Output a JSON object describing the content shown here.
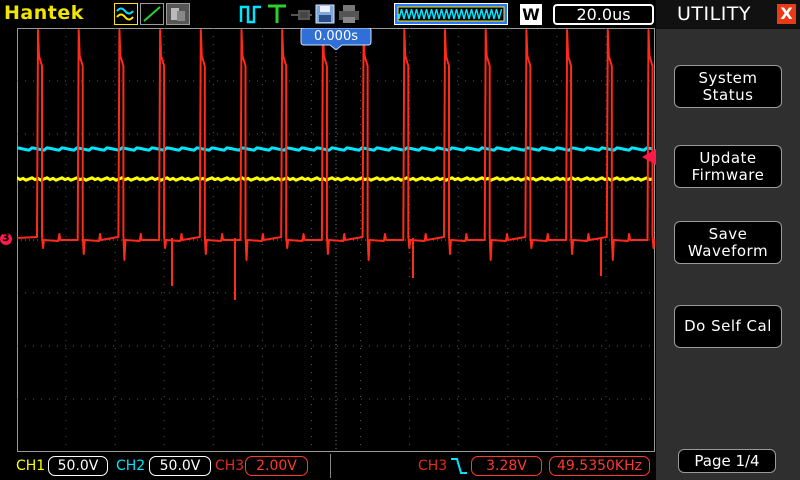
{
  "brand": "Hantek",
  "mem_depth_marker": "ΛΛΛΛΛΛΛΛΛΛΛ",
  "acq_mode": "W",
  "timebase": "20.0us",
  "trigger_position": "0.000s",
  "colors": {
    "ch1": "#ffff00",
    "ch2": "#00e5ff",
    "ch3": "#ff2a1a",
    "panel": "#2f2f2f",
    "close": "#e83a16"
  },
  "icons": [
    "analog-mode-icon",
    "xy-mode-icon",
    "roll-mode-icon",
    "pulse-trigger-icon",
    "trigger-icon",
    "probe-icon",
    "save-icon",
    "print-icon",
    "memory-depth-icon"
  ],
  "channels": {
    "ch1": {
      "label": "CH1",
      "scale": "50.0V"
    },
    "ch2": {
      "label": "CH2",
      "scale": "50.0V"
    },
    "ch3": {
      "label": "CH3",
      "scale": "2.00V"
    }
  },
  "trigger": {
    "source": "CH3",
    "level": "3.28V",
    "frequency": "49.5350KHz"
  },
  "ch3_marker": "3",
  "side_menu": {
    "title": "UTILITY",
    "close": "X",
    "buttons": [
      "System\nStatus",
      "Update\nFirmware",
      "Save\nWaveform",
      "Do Self Cal"
    ],
    "page": "Page 1/4"
  }
}
